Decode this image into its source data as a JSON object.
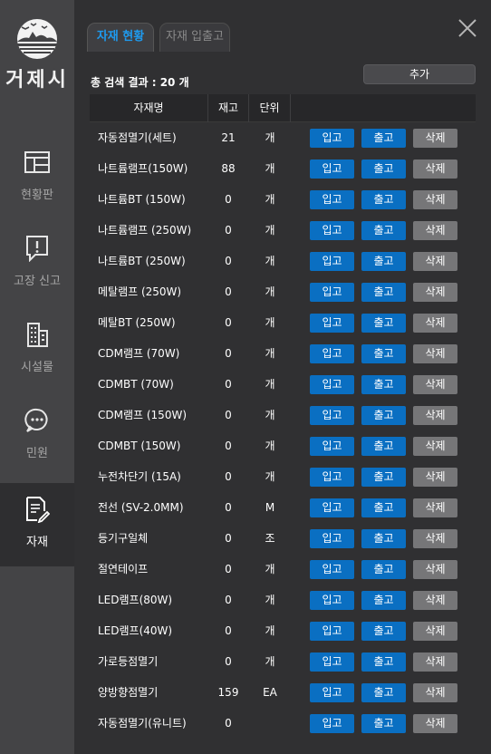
{
  "app": {
    "logo_text": "거제시"
  },
  "sidebar": {
    "items": [
      {
        "label": "현황판",
        "icon": "dashboard-icon"
      },
      {
        "label": "고장 신고",
        "icon": "report-icon"
      },
      {
        "label": "시설물",
        "icon": "building-icon"
      },
      {
        "label": "민원",
        "icon": "chat-icon"
      },
      {
        "label": "자재",
        "icon": "document-edit-icon",
        "active": true
      }
    ]
  },
  "tabs": [
    {
      "label": "자재 현황",
      "active": true
    },
    {
      "label": "자재 입출고",
      "active": false
    }
  ],
  "toolbar": {
    "result_text": "총 검색 결과 : 20 개",
    "add_label": "추가"
  },
  "table": {
    "headers": [
      "자재명",
      "재고",
      "단위"
    ],
    "buttons": {
      "in": "입고",
      "out": "출고",
      "del": "삭제"
    },
    "rows": [
      {
        "name": "자동점멸기(세트)",
        "qty": "21",
        "unit": "개"
      },
      {
        "name": "나트륨램프(150W)",
        "qty": "88",
        "unit": "개"
      },
      {
        "name": "나트륨BT (150W)",
        "qty": "0",
        "unit": "개"
      },
      {
        "name": "나트륨램프 (250W)",
        "qty": "0",
        "unit": "개"
      },
      {
        "name": "나트륨BT (250W)",
        "qty": "0",
        "unit": "개"
      },
      {
        "name": "메탈램프 (250W)",
        "qty": "0",
        "unit": "개"
      },
      {
        "name": "메탈BT (250W)",
        "qty": "0",
        "unit": "개"
      },
      {
        "name": "CDM램프 (70W)",
        "qty": "0",
        "unit": "개"
      },
      {
        "name": "CDMBT (70W)",
        "qty": "0",
        "unit": "개"
      },
      {
        "name": "CDM램프 (150W)",
        "qty": "0",
        "unit": "개"
      },
      {
        "name": "CDMBT (150W)",
        "qty": "0",
        "unit": "개"
      },
      {
        "name": "누전차단기 (15A)",
        "qty": "0",
        "unit": "개"
      },
      {
        "name": "전선 (SV-2.0MM)",
        "qty": "0",
        "unit": "M"
      },
      {
        "name": "등기구일체",
        "qty": "0",
        "unit": "조"
      },
      {
        "name": "절연테이프",
        "qty": "0",
        "unit": "개"
      },
      {
        "name": "LED램프(80W)",
        "qty": "0",
        "unit": "개"
      },
      {
        "name": "LED램프(40W)",
        "qty": "0",
        "unit": "개"
      },
      {
        "name": "가로등점멸기",
        "qty": "0",
        "unit": "개"
      },
      {
        "name": "양방향점멸기",
        "qty": "159",
        "unit": "EA"
      },
      {
        "name": "자동점멸기(유니트)",
        "qty": "0",
        "unit": ""
      }
    ]
  }
}
